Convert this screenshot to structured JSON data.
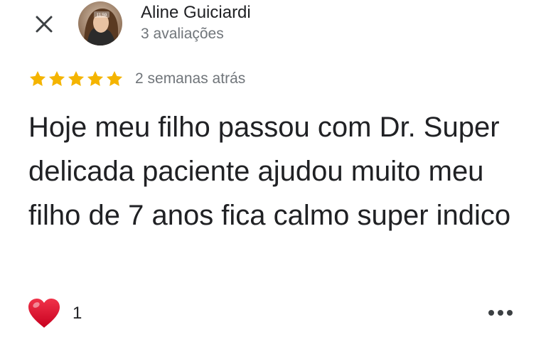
{
  "review": {
    "author_name": "Aline Guiciardi",
    "author_meta": "3 avaliações",
    "avatar_time": "11:59",
    "rating": 5,
    "max_rating": 5,
    "date": "2 semanas atrás",
    "text": "Hoje meu filho passou com Dr. Super delicada paciente ajudou muito meu filho de 7 anos fica calmo super indico",
    "reaction_icon": "heart-icon",
    "reaction_count": "1"
  },
  "colors": {
    "star": "#f4b400",
    "heart": "#e0122c",
    "text_primary": "#202124",
    "text_secondary": "#70757a"
  },
  "icons": {
    "close": "close-icon",
    "more": "more-options-icon"
  }
}
